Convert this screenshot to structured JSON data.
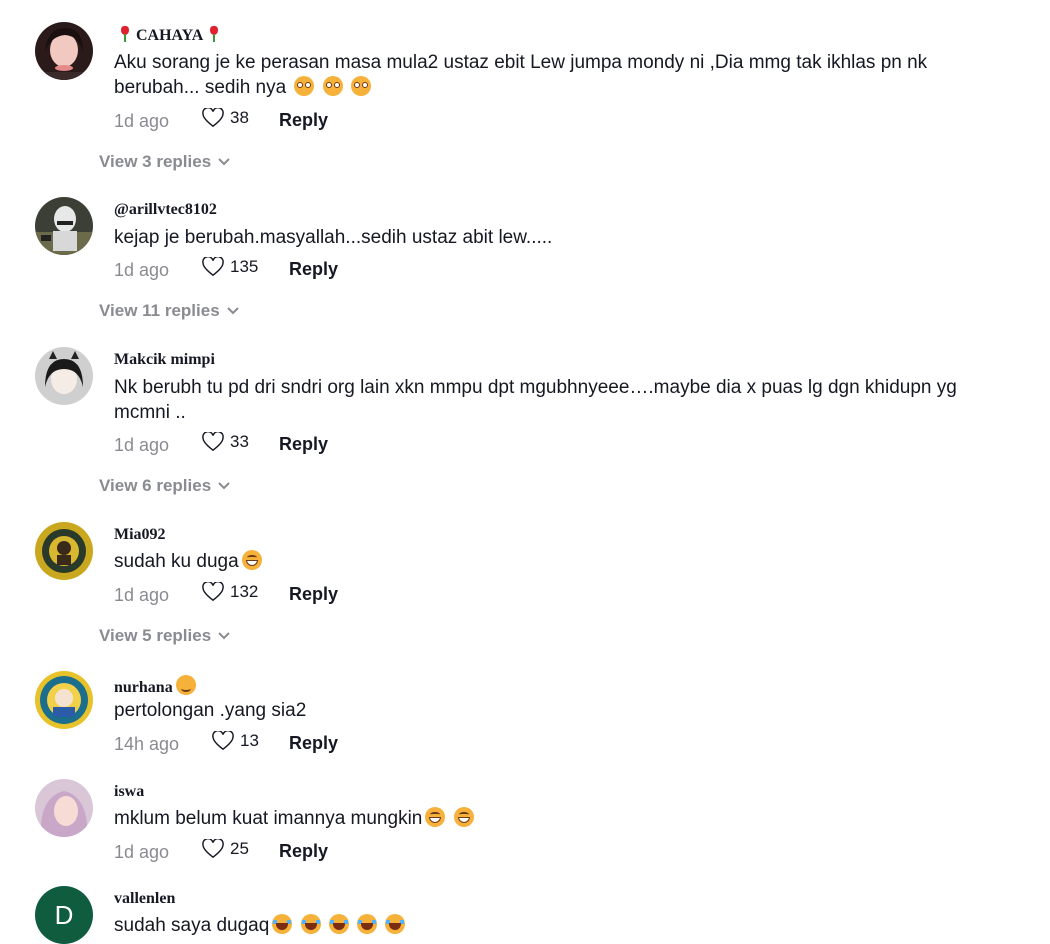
{
  "labels": {
    "reply": "Reply"
  },
  "comments": [
    {
      "username": "CAHAYA",
      "text": "Aku sorang je ke perasan masa mula2 ustaz ebit Lew jumpa mondy ni ,Dia mmg tak ikhlas pn nk berubah... sedih nya",
      "time": "1d ago",
      "likes": "38",
      "view_replies": "View 3 replies"
    },
    {
      "username": "@arillvtec8102",
      "text": "kejap je berubah.masyallah...sedih ustaz abit lew.....",
      "time": "1d ago",
      "likes": "135",
      "view_replies": "View 11 replies"
    },
    {
      "username": "Makcik mimpi",
      "text": "Nk berubh tu pd dri sndri org lain xkn mmpu dpt mgubhnyeee….maybe dia x puas lg dgn khidupn yg mcmni ..",
      "time": "1d ago",
      "likes": "33",
      "view_replies": "View 6 replies"
    },
    {
      "username": "Mia092",
      "text": "sudah ku duga",
      "time": "1d ago",
      "likes": "132",
      "view_replies": "View 5 replies"
    },
    {
      "username": "nurhana",
      "text": "pertolongan .yang sia2",
      "time": "14h ago",
      "likes": "13"
    },
    {
      "username": "iswa",
      "text": "mklum belum kuat imannya mungkin",
      "time": "1d ago",
      "likes": "25"
    },
    {
      "username": "vallenlen",
      "text": "sudah saya dugaq",
      "avatar_letter": "D",
      "avatar_color": "#0f5c3f"
    }
  ]
}
